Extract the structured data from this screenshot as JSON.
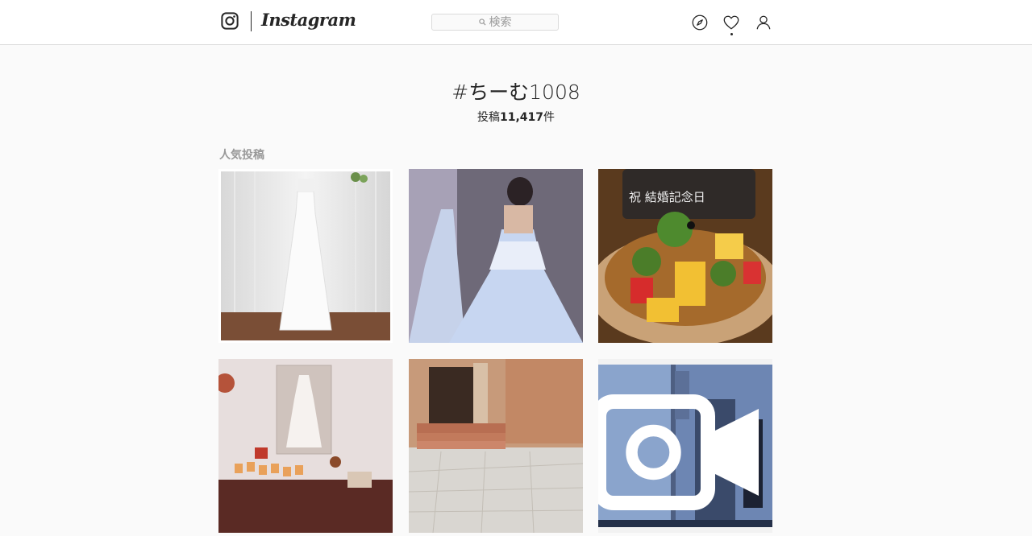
{
  "header": {
    "logo_text": "Instagram",
    "search": {
      "placeholder": "検索"
    },
    "icons": [
      "instagram-camera-icon",
      "compass-icon",
      "heart-icon",
      "profile-icon",
      "search-icon"
    ]
  },
  "hashtag": {
    "title": "#ちーむ1008",
    "count_prefix": "投稿",
    "count_value": "11,417",
    "count_suffix": "件"
  },
  "sections": {
    "top_posts_label": "人気投稿"
  },
  "posts": [
    {
      "subject": "white wedding dress on mannequin"
    },
    {
      "subject": "bride in light blue gown"
    },
    {
      "subject": "fruit tart with anniversary plaque",
      "plaque_text": "祝 結婚記念日"
    },
    {
      "subject": "wedding display with dress photo"
    },
    {
      "subject": "building entrance with stone steps"
    },
    {
      "subject": "video still of man in hallway",
      "is_video": true
    }
  ],
  "colors": {
    "background": "#fafafa",
    "text": "#262626",
    "muted": "#999999",
    "border": "#dbdbdb"
  }
}
